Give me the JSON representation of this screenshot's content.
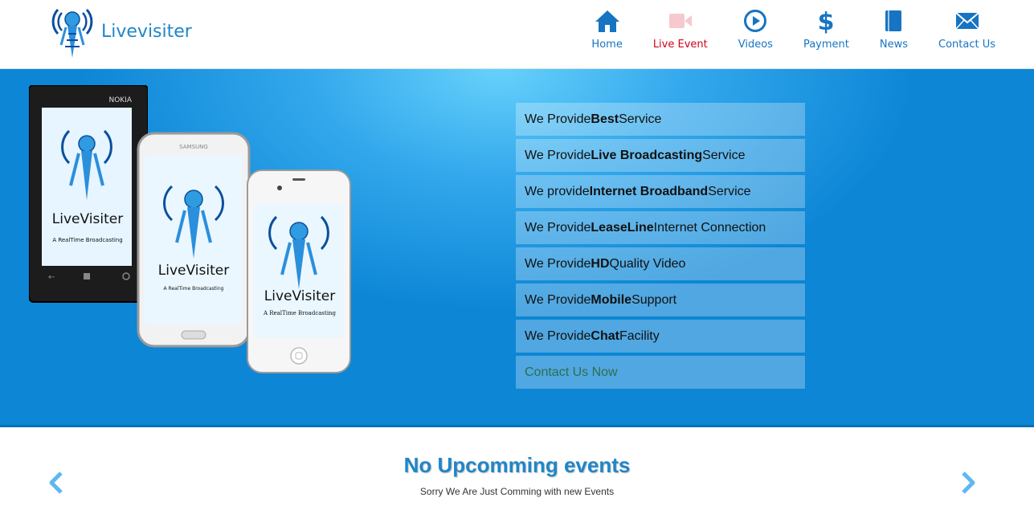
{
  "brand": {
    "name": "Livevisiter",
    "logo_icon": "broadcast-tower-logo-icon"
  },
  "nav": [
    {
      "label": "Home",
      "icon": "home-icon",
      "active": false
    },
    {
      "label": "Live Event",
      "icon": "video-camera-icon",
      "active": true
    },
    {
      "label": "Videos",
      "icon": "play-circle-icon",
      "active": false
    },
    {
      "label": "Payment",
      "icon": "dollar-icon",
      "active": false
    },
    {
      "label": "News",
      "icon": "book-icon",
      "active": false
    },
    {
      "label": "Contact Us",
      "icon": "envelope-icon",
      "active": false
    }
  ],
  "hero": {
    "phones": [
      {
        "maker": "NOKIA",
        "app_name": "LiveVisiter",
        "tagline": "A  RealTime  Broadcasting"
      },
      {
        "maker": "SAMSUNG",
        "app_name": "LiveVisiter",
        "tagline": "A  RealTime  Broadcasting"
      },
      {
        "maker": "",
        "app_name": "LiveVisiter",
        "tagline": "A RealTime Broadcasting"
      }
    ],
    "features": [
      {
        "pre": "We Provide ",
        "bold": "Best",
        "post": " Service"
      },
      {
        "pre": "We Provide ",
        "bold": "Live Broadcasting",
        "post": " Service"
      },
      {
        "pre": "We provide ",
        "bold": "Internet Broadband",
        "post": " Service"
      },
      {
        "pre": "We Provide ",
        "bold": "LeaseLine",
        "post": " Internet Connection"
      },
      {
        "pre": "We Provide ",
        "bold": "HD",
        "post": " Quality Video"
      },
      {
        "pre": "We Provide ",
        "bold": "Mobile",
        "post": " Support"
      },
      {
        "pre": "We Provide ",
        "bold": "Chat",
        "post": " Facility"
      }
    ],
    "cta": "Contact Us Now"
  },
  "events": {
    "title": "No Upcomming events",
    "subtitle": "Sorry We Are Just Comming with new Events",
    "prev_icon": "chevron-left-icon",
    "next_icon": "chevron-right-icon"
  },
  "colors": {
    "brand": "#1f86c9",
    "active_nav": "#d0021b",
    "hero": "#33a8ec"
  }
}
